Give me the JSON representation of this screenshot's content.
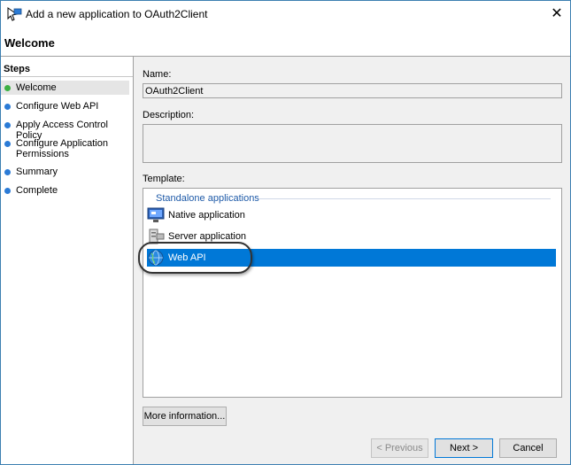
{
  "window": {
    "title": "Add a new application to OAuth2Client",
    "close_glyph": "✕"
  },
  "header": {
    "title": "Welcome"
  },
  "steps": {
    "heading": "Steps",
    "items": [
      {
        "label": "Welcome",
        "status": "current"
      },
      {
        "label": "Configure Web API",
        "status": "pending"
      },
      {
        "label": "Apply Access Control Policy",
        "status": "pending"
      },
      {
        "label": "Configure Application Permissions",
        "status": "pending"
      },
      {
        "label": "Summary",
        "status": "pending"
      },
      {
        "label": "Complete",
        "status": "pending"
      }
    ]
  },
  "form": {
    "name_label": "Name:",
    "name_value": "OAuth2Client",
    "description_label": "Description:",
    "description_value": "",
    "template_label": "Template:"
  },
  "templates": {
    "group_label": "Standalone applications",
    "items": [
      {
        "label": "Native application",
        "icon": "native-app-icon",
        "selected": false
      },
      {
        "label": "Server application",
        "icon": "server-app-icon",
        "selected": false
      },
      {
        "label": "Web API",
        "icon": "web-api-globe-icon",
        "selected": true
      }
    ]
  },
  "buttons": {
    "more_info": "More information...",
    "previous": "< Previous",
    "next": "Next >",
    "cancel": "Cancel"
  },
  "colors": {
    "selection": "#0078d7",
    "step_current": "#3cb043",
    "step_pending": "#2b7bd6",
    "group_header": "#1e5aa8"
  }
}
